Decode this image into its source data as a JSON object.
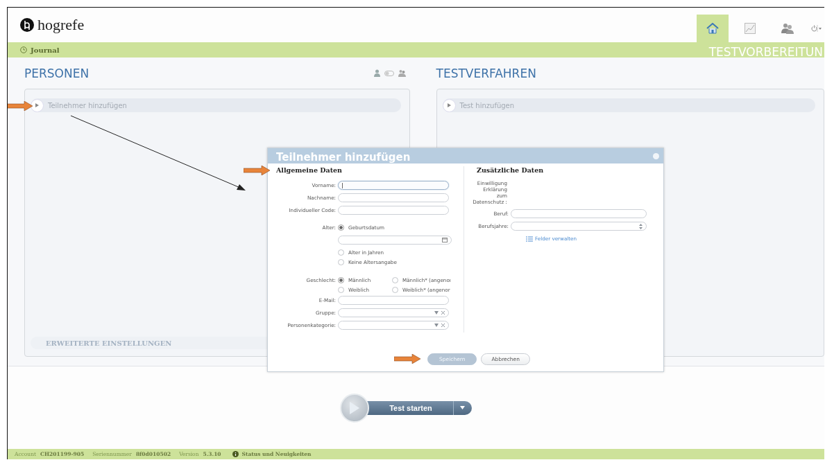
{
  "header": {
    "logo": "hogrefe",
    "nav": [
      {
        "kind": "home",
        "selected": true
      },
      {
        "kind": "chart",
        "selected": false
      },
      {
        "kind": "people",
        "selected": false
      },
      {
        "kind": "power",
        "selected": false
      }
    ]
  },
  "breadcrumb_bar": {
    "link": "Journal",
    "section_title": "TESTVORBEREITUN"
  },
  "personen": {
    "title": "PERSONEN",
    "add_row": "Teilnehmer hinzufügen",
    "advanced": "ERWEITERTE EINSTELLUNGEN"
  },
  "testverfahren": {
    "title": "TESTVERFAHREN",
    "add_row": "Test hinzufügen"
  },
  "dialog": {
    "title": "Teilnehmer hinzufügen",
    "general": {
      "heading": "Allgemeine Daten",
      "fields_top": [
        {
          "label": "Vorname:",
          "kind": "text",
          "focused": true
        },
        {
          "label": "Nachname:",
          "kind": "text",
          "focused": false
        },
        {
          "label": "Individueller Code:",
          "kind": "text",
          "focused": false
        }
      ],
      "age": {
        "label": "Alter:",
        "options": [
          {
            "label": "Geburtsdatum",
            "selected": true
          },
          {
            "label": "Alter in Jahren",
            "selected": false
          },
          {
            "label": "Keine Altersangabe",
            "selected": false
          }
        ]
      },
      "gender": {
        "label": "Geschlecht:",
        "options": [
          {
            "label": "Männlich",
            "selected": true
          },
          {
            "label": "Männlich* (angenoı",
            "selected": false
          },
          {
            "label": "Weiblich",
            "selected": false
          },
          {
            "label": "Weiblich* (angenor",
            "selected": false
          }
        ]
      },
      "fields_bottom": [
        {
          "label": "E-Mail:",
          "kind": "text",
          "focused": false
        },
        {
          "label": "Gruppe:",
          "kind": "combo",
          "focused": false
        },
        {
          "label": "Personenkategorie:",
          "kind": "combo",
          "focused": false
        }
      ]
    },
    "extra": {
      "heading": "Zusätzliche Daten",
      "consent_label": "Einwilligung Erklärung zum Datenschutz :",
      "fields": [
        {
          "label": "Beruf:",
          "kind": "text",
          "focused": false
        },
        {
          "label": "Berufsjahre:",
          "kind": "number",
          "focused": false
        }
      ],
      "manage_link": "Felder verwalten"
    },
    "buttons": [
      {
        "label": "Speichern",
        "disabled": true
      },
      {
        "label": "Abbrechen",
        "disabled": false
      }
    ]
  },
  "start": {
    "label": "Test starten"
  },
  "status_bar": {
    "items": [
      {
        "label": "Account",
        "value": "CH201199-905"
      },
      {
        "label": "Seriennummer",
        "value": "8f0d010502"
      },
      {
        "label": "Version",
        "value": "5.3.10"
      }
    ],
    "link": "Status und Neuigkeiten"
  }
}
